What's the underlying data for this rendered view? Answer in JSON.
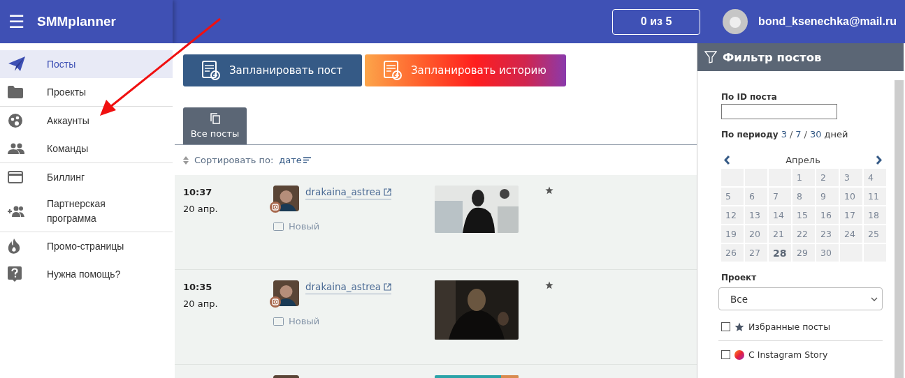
{
  "header": {
    "menu_icon": "☰",
    "logo": "SMMplanner",
    "counter": "0 из 5",
    "user_email": "bond_ksenechka@mail.ru"
  },
  "sidebar": {
    "sections": [
      [
        {
          "label": "Посты",
          "kind": "send",
          "selected": true
        },
        {
          "label": "Проекты",
          "kind": "folder",
          "selected": false
        }
      ],
      [
        {
          "label": "Аккаунты",
          "kind": "accounts",
          "selected": false
        },
        {
          "label": "Команды",
          "kind": "team",
          "selected": false
        }
      ],
      [
        {
          "label": "Биллинг",
          "kind": "card",
          "selected": false
        },
        {
          "label": "Партнерская программа",
          "kind": "partner",
          "selected": false
        }
      ],
      [
        {
          "label": "Промо-страницы",
          "kind": "fire",
          "selected": false
        },
        {
          "label": "Нужна помощь?",
          "kind": "help",
          "selected": false
        }
      ]
    ]
  },
  "actions": [
    {
      "label": "Запланировать пост",
      "kind": "post"
    },
    {
      "label": "Запланировать историю",
      "kind": "story"
    }
  ],
  "tabs": [
    {
      "label": "Все посты",
      "selected": true
    }
  ],
  "sort": {
    "label": "Сортировать по:",
    "value": "дате"
  },
  "posts": [
    {
      "kind": "post",
      "time": "10:37",
      "date": "20 апр.",
      "account": "drakaina_astrea",
      "status": "Новый"
    },
    {
      "kind": "post",
      "time": "10:35",
      "date": "20 апр.",
      "account": "drakaina_astrea",
      "status": "Новый"
    },
    {
      "kind": "partial"
    }
  ],
  "filter": {
    "title": "Фильтр постов",
    "id_label": "По ID поста",
    "period_label": "По периоду",
    "periods": [
      "3",
      "7",
      "30"
    ],
    "period_separator": "/",
    "period_unit": "дней",
    "calendar": {
      "month": "Апрель",
      "weeks": [
        [
          {
            "kind": "blank"
          },
          {
            "kind": "blank"
          },
          {
            "kind": "blank"
          },
          {
            "day": "1",
            "today": false
          },
          {
            "day": "2",
            "today": false
          },
          {
            "day": "3",
            "today": false
          },
          {
            "day": "4",
            "today": false
          }
        ],
        [
          {
            "day": "5",
            "today": false
          },
          {
            "day": "6",
            "today": false
          },
          {
            "day": "7",
            "today": false
          },
          {
            "day": "8",
            "today": false
          },
          {
            "day": "9",
            "today": false
          },
          {
            "day": "10",
            "today": false
          },
          {
            "day": "11",
            "today": false
          }
        ],
        [
          {
            "day": "12",
            "today": false
          },
          {
            "day": "13",
            "today": false
          },
          {
            "day": "14",
            "today": false
          },
          {
            "day": "15",
            "today": false
          },
          {
            "day": "16",
            "today": false
          },
          {
            "day": "17",
            "today": false
          },
          {
            "day": "18",
            "today": false
          }
        ],
        [
          {
            "day": "19",
            "today": false
          },
          {
            "day": "20",
            "today": false
          },
          {
            "day": "21",
            "today": false
          },
          {
            "day": "22",
            "today": false
          },
          {
            "day": "23",
            "today": false
          },
          {
            "day": "24",
            "today": false
          },
          {
            "day": "25",
            "today": false
          }
        ],
        [
          {
            "day": "26",
            "today": false
          },
          {
            "day": "27",
            "today": false
          },
          {
            "day": "28",
            "today": true
          },
          {
            "day": "29",
            "today": false
          },
          {
            "day": "30",
            "today": false
          },
          {
            "kind": "blank"
          },
          {
            "kind": "blank"
          }
        ]
      ]
    },
    "project_label": "Проект",
    "project_value": "Все",
    "options": [
      {
        "label": "Избранные посты",
        "kind": "star",
        "checked": false
      },
      {
        "label": "С Instagram Story",
        "kind": "story",
        "checked": false
      }
    ]
  }
}
